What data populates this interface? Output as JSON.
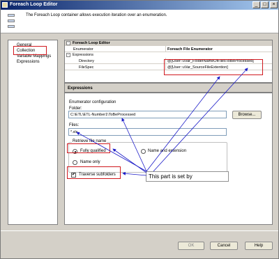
{
  "window": {
    "title": "Foreach Loop Editor",
    "controls": [
      "_",
      "□",
      "×"
    ]
  },
  "header": {
    "description": "The Foreach Loop container allows execution iteration over an enumeration."
  },
  "nav": {
    "items": [
      {
        "label": "General"
      },
      {
        "label": "Collection"
      },
      {
        "label": "Variable Mappings"
      },
      {
        "label": "Expressions"
      }
    ]
  },
  "grid": {
    "category_editor": "Foreach Loop Editor",
    "enumerator_label": "Enumerator",
    "enumerator_value": "Foreach File Enumerator",
    "category_expressions": "Expressions",
    "directory_label": "Directory",
    "directory_value": "@[User::uVar_FolderNameOfFilesToBeProcessed]",
    "filespec_label": "FileSpec",
    "filespec_value": "@[User::uVar_SourceFileExtention]",
    "expand_toggle": "-"
  },
  "description_pane": {
    "title": "Expressions"
  },
  "enum_config": {
    "section_label": "Enumerator configuration",
    "folder_label": "Folder:",
    "folder_value": "C:\\ETL\\ETL-Number1\\ToBeProcessed",
    "browse_label": "Browse...",
    "files_label": "Files:",
    "files_value": "*.xls",
    "retrieve_label": "Retrieve file name",
    "opt_fully_qualified": "Fully qualified",
    "opt_name_extension": "Name and extension",
    "opt_name_only": "Name only",
    "traverse_label": "Traverse subfolders",
    "traverse_checked": "✔"
  },
  "annotation": {
    "callout_text": "This part is set by",
    "color": "#d0181e",
    "arrow_color": "#1c1cc8"
  },
  "footer": {
    "ok_label": "OK",
    "cancel_label": "Cancel",
    "help_label": "Help"
  }
}
